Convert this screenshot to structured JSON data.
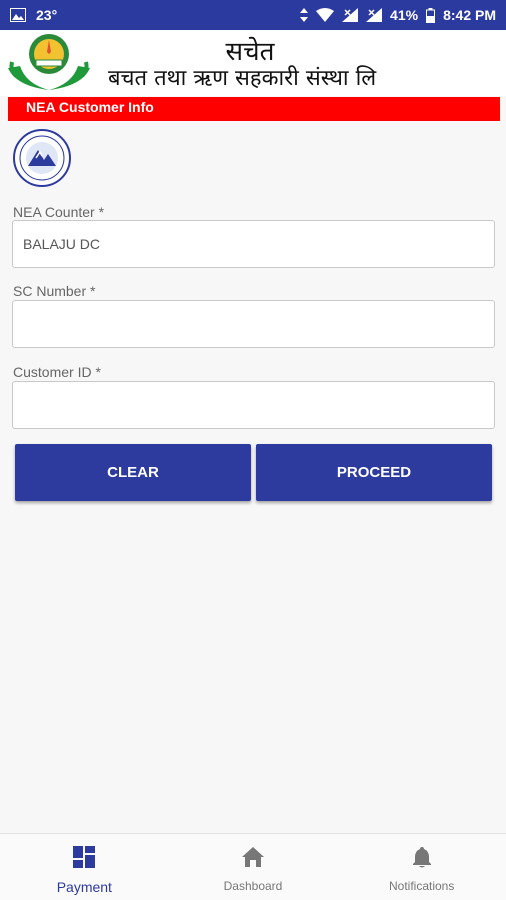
{
  "status_bar": {
    "temperature": "23°",
    "battery": "41%",
    "time": "8:42 PM"
  },
  "header": {
    "org_name": "सचेत",
    "org_subname": "बचत तथा ऋण सहकारी संस्था लि"
  },
  "info_bar": {
    "title": "NEA Customer Info"
  },
  "form": {
    "nea_counter": {
      "label": "NEA Counter *",
      "value": "BALAJU DC"
    },
    "sc_number": {
      "label": "SC Number *",
      "value": ""
    },
    "customer_id": {
      "label": "Customer ID *",
      "value": ""
    }
  },
  "buttons": {
    "clear": "CLEAR",
    "proceed": "PROCEED"
  },
  "bottom_nav": {
    "items": [
      {
        "label": "Payment",
        "icon": "dashboard-grid-icon"
      },
      {
        "label": "Dashboard",
        "icon": "home-icon"
      },
      {
        "label": "Notifications",
        "icon": "bell-icon"
      }
    ],
    "active": "Payment"
  },
  "colors": {
    "primary": "#2e3b9e",
    "status_bar": "#2b3a9e",
    "alert_red": "#ff0000"
  }
}
